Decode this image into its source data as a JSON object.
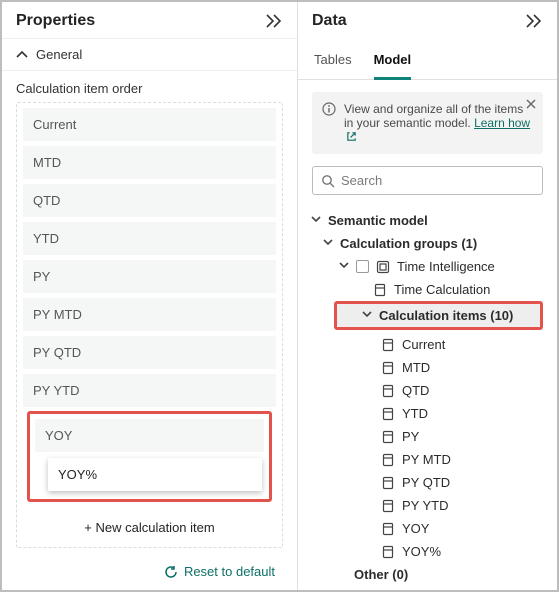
{
  "properties": {
    "title": "Properties",
    "general_label": "General",
    "order_label": "Calculation item order",
    "items": [
      "Current",
      "MTD",
      "QTD",
      "YTD",
      "PY",
      "PY MTD",
      "PY QTD",
      "PY YTD"
    ],
    "highlighted": {
      "a": "YOY",
      "b": "YOY%"
    },
    "new_item_label": "+ New calculation item",
    "reset_label": "Reset to default"
  },
  "data": {
    "title": "Data",
    "tabs": {
      "tables": "Tables",
      "model": "Model"
    },
    "info_text": "View and organize all of the items in your semantic model. ",
    "info_link": "Learn how",
    "search_placeholder": "Search",
    "tree": {
      "root": "Semantic model",
      "calc_groups": "Calculation groups (1)",
      "time_intel": "Time Intelligence",
      "time_calc": "Time Calculation",
      "calc_items": "Calculation items (10)",
      "items": [
        "Current",
        "MTD",
        "QTD",
        "YTD",
        "PY",
        "PY MTD",
        "PY QTD",
        "PY YTD",
        "YOY",
        "YOY%"
      ],
      "other": "Other (0)"
    }
  }
}
